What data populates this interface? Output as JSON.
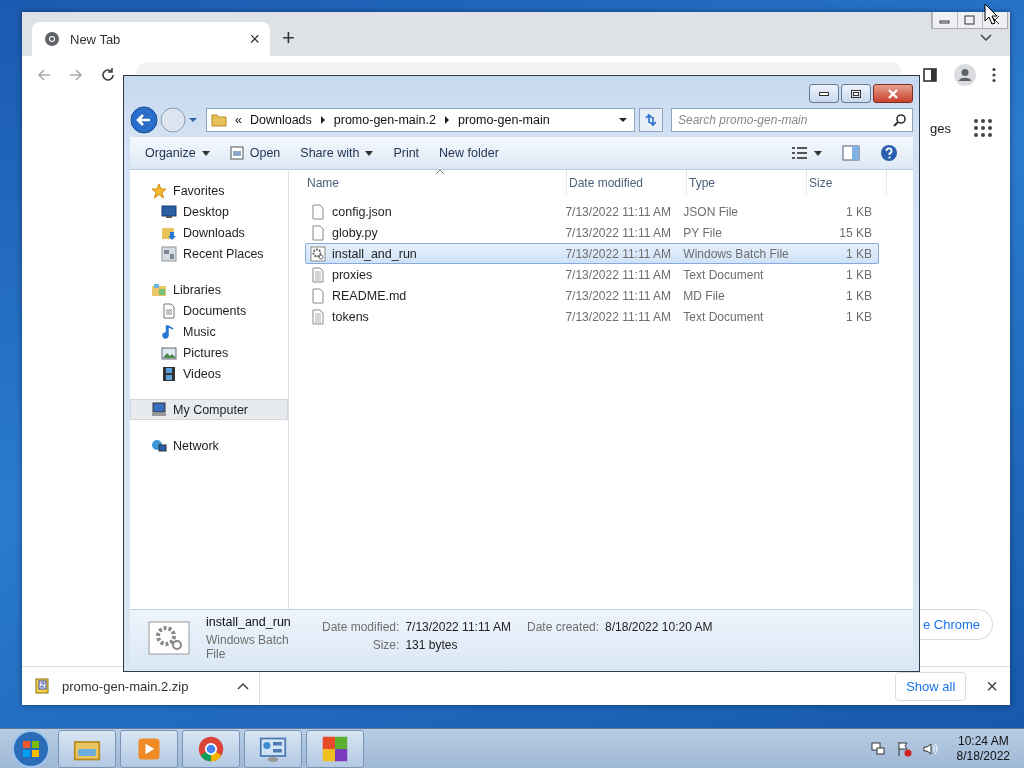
{
  "browser": {
    "tab": {
      "title": "New Tab",
      "close": "×"
    },
    "new_tab": "+",
    "page_fragments": [
      "ges",
      "e Chrome"
    ],
    "download": {
      "filename": "promo-gen-main.2.zip",
      "show_all": "Show all",
      "close": "×"
    }
  },
  "explorer": {
    "address": {
      "prefix": "«",
      "crumbs": [
        "Downloads",
        "promo-gen-main.2",
        "promo-gen-main"
      ]
    },
    "search": {
      "placeholder": "Search promo-gen-main"
    },
    "commands": [
      {
        "label": "Organize",
        "kind": "menu"
      },
      {
        "label": "Open",
        "kind": "icon"
      },
      {
        "label": "Share with",
        "kind": "menu"
      },
      {
        "label": "Print",
        "kind": "plain"
      },
      {
        "label": "New folder",
        "kind": "plain"
      }
    ],
    "nav": [
      {
        "label": "Favorites",
        "kind": "star",
        "selected": false,
        "children": [
          {
            "label": "Desktop",
            "kind": "desktop",
            "selected": false
          },
          {
            "label": "Downloads",
            "kind": "downloads",
            "selected": false
          },
          {
            "label": "Recent Places",
            "kind": "recent",
            "selected": false
          }
        ]
      },
      {
        "label": "Libraries",
        "kind": "libraries",
        "selected": false,
        "children": [
          {
            "label": "Documents",
            "kind": "document",
            "selected": false
          },
          {
            "label": "Music",
            "kind": "music",
            "selected": false
          },
          {
            "label": "Pictures",
            "kind": "pictures",
            "selected": false
          },
          {
            "label": "Videos",
            "kind": "videos",
            "selected": false
          }
        ]
      },
      {
        "label": "My Computer",
        "kind": "computer",
        "selected": true
      },
      {
        "label": "Network",
        "kind": "network",
        "selected": false
      }
    ],
    "columns": [
      {
        "label": "Name",
        "sorted": true
      },
      {
        "label": "Date modified",
        "sorted": false
      },
      {
        "label": "Type",
        "sorted": false
      },
      {
        "label": "Size",
        "sorted": false
      }
    ],
    "files": [
      {
        "name": "config.json",
        "kind": "blank",
        "date": "7/13/2022 11:11 AM",
        "type": "JSON File",
        "size": "1 KB",
        "selected": false
      },
      {
        "name": "globy.py",
        "kind": "blank",
        "date": "7/13/2022 11:11 AM",
        "type": "PY File",
        "size": "15 KB",
        "selected": false
      },
      {
        "name": "install_and_run",
        "kind": "batch",
        "date": "7/13/2022 11:11 AM",
        "type": "Windows Batch File",
        "size": "1 KB",
        "selected": true
      },
      {
        "name": "proxies",
        "kind": "text",
        "date": "7/13/2022 11:11 AM",
        "type": "Text Document",
        "size": "1 KB",
        "selected": false
      },
      {
        "name": "README.md",
        "kind": "blank",
        "date": "7/13/2022 11:11 AM",
        "type": "MD File",
        "size": "1 KB",
        "selected": false
      },
      {
        "name": "tokens",
        "kind": "text",
        "date": "7/13/2022 11:11 AM",
        "type": "Text Document",
        "size": "1 KB",
        "selected": false
      }
    ],
    "details": {
      "name": "install_and_run",
      "type": "Windows Batch File",
      "fields": [
        {
          "label": "Date modified:",
          "value": "7/13/2022 11:11 AM"
        },
        {
          "label": "Date created:",
          "value": "8/18/2022 10:20 AM"
        },
        {
          "label": "Size:",
          "value": "131 bytes"
        }
      ]
    }
  },
  "taskbar": {
    "items": [
      {
        "kind": "explorer"
      },
      {
        "kind": "media"
      },
      {
        "kind": "chrome"
      },
      {
        "kind": "control"
      },
      {
        "kind": "app"
      }
    ],
    "time": "10:24 AM",
    "date": "8/18/2022"
  }
}
